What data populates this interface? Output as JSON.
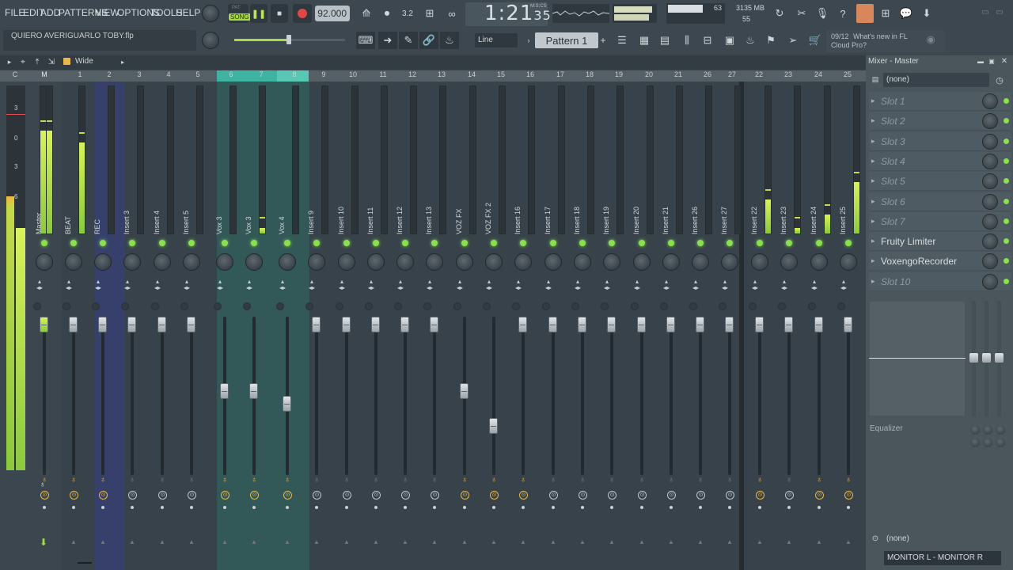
{
  "menu": [
    "FILE",
    "EDIT",
    "ADD",
    "PATTERNS",
    "VIEW",
    "OPTIONS",
    "TOOLS",
    "HELP"
  ],
  "transport": {
    "mode_label": "SONG",
    "pat_label": "PAT",
    "bpm": "92.000",
    "time_main": "1:21",
    "time_sub": "35",
    "time_unit": "M:S:CS"
  },
  "status": {
    "cpu": "63",
    "memory": "3135 MB",
    "polyphony": "55"
  },
  "project": {
    "name": "QUIERO AVERIGUARLO TOBY.flp",
    "snap": "Line",
    "pattern": "Pattern 1"
  },
  "news": {
    "counter": "09/12",
    "line1": "What's new in FL",
    "line2": "Cloud Pro?"
  },
  "mixer": {
    "view_mode": "Wide",
    "header_c": "C",
    "header_m": "M",
    "numbers": [
      "1",
      "2",
      "3",
      "4",
      "5",
      "6",
      "7",
      "8",
      "9",
      "10",
      "11",
      "12",
      "13",
      "14",
      "15",
      "16",
      "17",
      "18",
      "19",
      "20",
      "21",
      "26",
      "27",
      "22",
      "23",
      "24",
      "25"
    ],
    "scale": [
      "3",
      "0",
      "3",
      "6"
    ],
    "tracks": [
      {
        "name": "Master",
        "level": 0.7
      },
      {
        "name": "BEAT",
        "level": 0.62
      },
      {
        "name": "REC",
        "level": 0
      },
      {
        "name": "Insert 3",
        "level": 0
      },
      {
        "name": "Insert 4",
        "level": 0
      },
      {
        "name": "Insert 5",
        "level": 0
      },
      {
        "name": "Vox 3",
        "level": 0
      },
      {
        "name": "Vox 3",
        "level": 0.04
      },
      {
        "name": "Vox 4",
        "level": 0
      },
      {
        "name": "Insert 9",
        "level": 0
      },
      {
        "name": "Insert 10",
        "level": 0
      },
      {
        "name": "Insert 11",
        "level": 0
      },
      {
        "name": "Insert 12",
        "level": 0
      },
      {
        "name": "Insert 13",
        "level": 0
      },
      {
        "name": "VOZ FX",
        "level": 0
      },
      {
        "name": "VOZ FX 2",
        "level": 0
      },
      {
        "name": "Insert 16",
        "level": 0
      },
      {
        "name": "Insert 17",
        "level": 0
      },
      {
        "name": "Insert 18",
        "level": 0
      },
      {
        "name": "Insert 19",
        "level": 0
      },
      {
        "name": "Insert 20",
        "level": 0
      },
      {
        "name": "Insert 21",
        "level": 0
      },
      {
        "name": "Insert 26",
        "level": 0
      },
      {
        "name": "Insert 27",
        "level": 0
      },
      {
        "name": "Insert 22",
        "level": 0.23
      },
      {
        "name": "Insert 23",
        "level": 0.04
      },
      {
        "name": "Insert 24",
        "level": 0.13
      },
      {
        "name": "Insert 25",
        "level": 0.35
      }
    ]
  },
  "panel": {
    "title": "Mixer - Master",
    "preset": "(none)",
    "slots": [
      "Slot 1",
      "Slot 2",
      "Slot 3",
      "Slot 4",
      "Slot 5",
      "Slot 6",
      "Slot 7",
      "Fruity Limiter",
      "VoxengoRecorder",
      "Slot 10"
    ],
    "eq_label": "Equalizer",
    "output_none": "(none)",
    "output": "MONITOR L - MONITOR R"
  },
  "colors": {
    "accent": "#8be04e",
    "selected_cols": "#2f6b64",
    "selected_hdr": "#3fb3a2",
    "rec_col": "#36406b"
  }
}
